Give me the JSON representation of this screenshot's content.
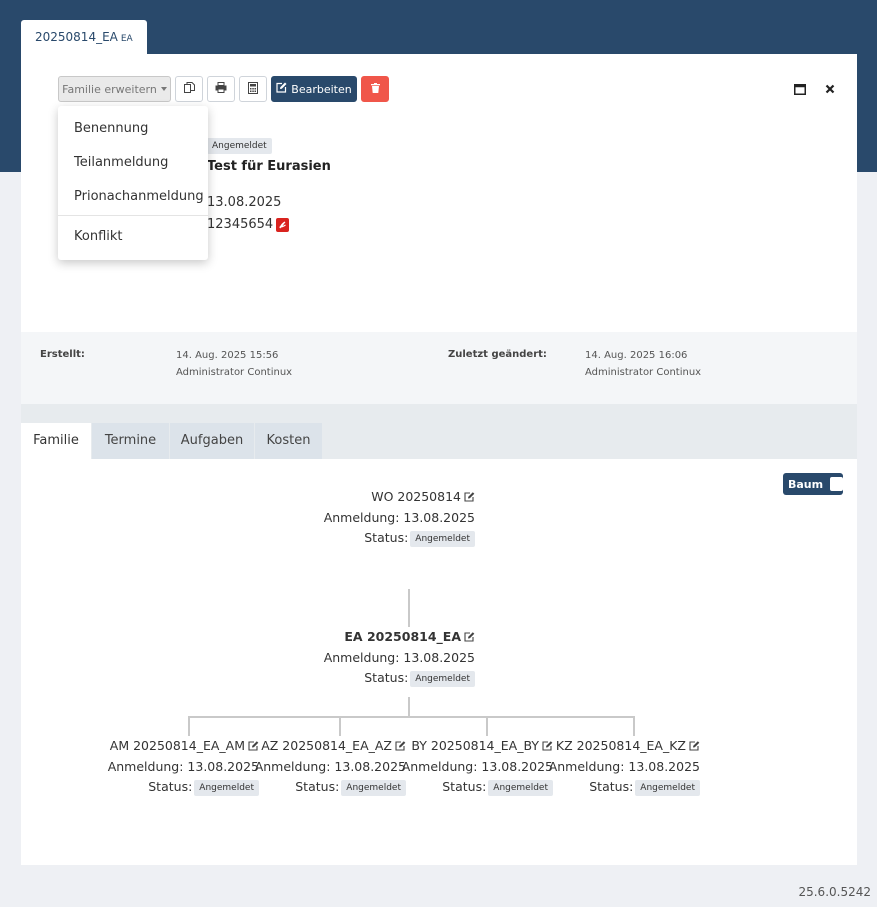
{
  "doc_tab": {
    "label": "20250814_EA",
    "suffix": "EA"
  },
  "toolbar": {
    "family_label": "Familie erweitern",
    "edit_label": "Bearbeiten"
  },
  "dropdown": {
    "items": [
      "Benennung",
      "Teilanmeldung",
      "Prionachanmeldung",
      "Konflikt"
    ]
  },
  "info": {
    "status": "Angemeldet",
    "title": "Test für Eurasien",
    "date": "13.08.2025",
    "number": "12345654"
  },
  "meta": {
    "created_label": "Erstellt:",
    "created_date": "14. Aug. 2025 15:56",
    "created_by": "Administrator Continux",
    "changed_label": "Zuletzt geändert:",
    "changed_date": "14. Aug. 2025 16:06",
    "changed_by": "Administrator Continux"
  },
  "tabs": [
    "Familie",
    "Termine",
    "Aufgaben",
    "Kosten"
  ],
  "tree": {
    "toggle_label": "Baum",
    "status_label": "Status:",
    "nodes": [
      {
        "name": "WO 20250814",
        "anmeldung": "Anmeldung: 13.08.2025",
        "status": "Angemeldet"
      },
      {
        "name": "EA 20250814_EA",
        "anmeldung": "Anmeldung: 13.08.2025",
        "status": "Angemeldet"
      },
      {
        "name": "AM 20250814_EA_AM",
        "anmeldung": "Anmeldung: 13.08.2025",
        "status": "Angemeldet"
      },
      {
        "name": "AZ 20250814_EA_AZ",
        "anmeldung": "Anmeldung: 13.08.2025",
        "status": "Angemeldet"
      },
      {
        "name": "BY 20250814_EA_BY",
        "anmeldung": "Anmeldung: 13.08.2025",
        "status": "Angemeldet"
      },
      {
        "name": "KZ 20250814_EA_KZ",
        "anmeldung": "Anmeldung: 13.08.2025",
        "status": "Angemeldet"
      }
    ]
  },
  "version": "25.6.0.5242",
  "colors": {
    "primary": "#29496b",
    "danger": "#f0564a",
    "badge_bg": "#e4e8ed"
  }
}
